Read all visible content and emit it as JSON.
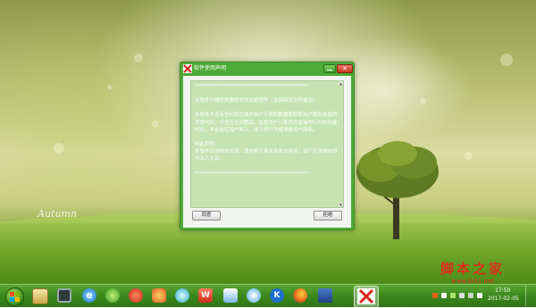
{
  "wallpaper": {
    "script_text": "Autumn",
    "watermark_title": "脚本之家",
    "watermark_url": "www.jb51.net"
  },
  "dialog": {
    "title": "软件使用声明",
    "app_icon": "red-x-logo-icon",
    "close_label": "✕",
    "stars": "****************************************************",
    "paragraphs": [
      "本软件为绿色免费的文件加密软件（支持所有文件格式）",
      "本软件不含有任何旨在破坏用户计算机数据和获取用户隐私信息的恶意代码，不含有任何跟踪、监视用户计算机的或操作行为的功能代码，不会监控用户网上、网下的行为或泄露用户隐私。",
      "特此声明：",
      "本软件仅供技术交流，请勿用于商业及非法用途，如产生法律纠纷与本人无关。"
    ],
    "agree_label": "同意",
    "reject_label": "拒绝"
  },
  "taskbar": {
    "start_icon": "windows-orb-icon",
    "pinned_icons": [
      "library-folder-icon",
      "monitor-icon",
      "ie-icon",
      "globe-app-icon",
      "game-icon",
      "butterfly-app-icon",
      "gem-app-icon",
      "wps-icon",
      "photo-app-icon",
      "cloud-icon",
      "k-app-icon",
      "firefox-icon",
      "ladder-app-icon",
      "encrypt-app-icon"
    ],
    "clock_time": "17:50",
    "clock_date": "2017-02-05"
  },
  "colors": {
    "dialog_frame": "#4cab36",
    "text_pane": "#c5e4b2",
    "taskbar": "#3d8a1e",
    "watermark": "#d8301a"
  }
}
